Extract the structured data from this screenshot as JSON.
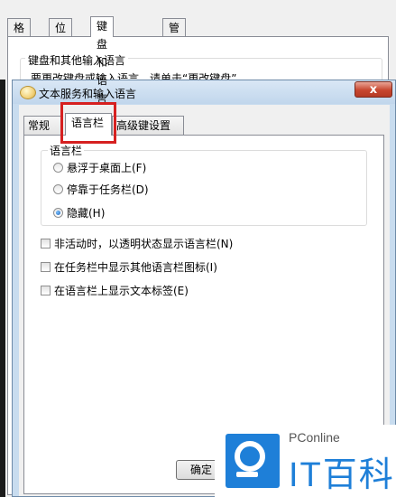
{
  "background_dialog": {
    "tabs": [
      "格式",
      "位置",
      "键盘和语言",
      "管理"
    ],
    "selected_tab": "键盘和语言",
    "group_title": "键盘和其他输入语言",
    "text": "要更改键盘或输入语言，请单击“更改键盘”"
  },
  "dialog": {
    "title": "文本服务和输入语言",
    "close_label": "x",
    "tabs": [
      "常规",
      "语言栏",
      "高级键设置"
    ],
    "selected_tab": "语言栏",
    "group_title": "语言栏",
    "radios": [
      {
        "label": "悬浮于桌面上(F)",
        "checked": false
      },
      {
        "label": "停靠于任务栏(D)",
        "checked": false
      },
      {
        "label": "隐藏(H)",
        "checked": true
      }
    ],
    "checkboxes": [
      {
        "label": "非活动时，以透明状态显示语言栏(N)",
        "checked": false
      },
      {
        "label": "在任务栏中显示其他语言栏图标(I)",
        "checked": false
      },
      {
        "label": "在语言栏上显示文本标签(E)",
        "checked": false
      }
    ],
    "ok_label": "确定"
  },
  "watermark": {
    "top_text": "PConline",
    "brand": "IT百科"
  },
  "colors": {
    "highlight": "#d62020",
    "close_button": "#c7462f",
    "brand_blue": "#1e7fd8"
  }
}
